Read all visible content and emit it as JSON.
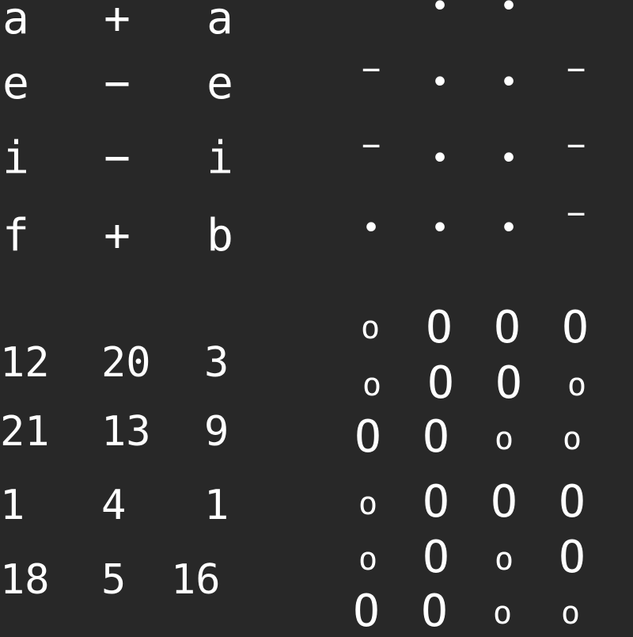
{
  "letter_grid": {
    "rows": [
      [
        "a",
        "+",
        "a"
      ],
      [
        "e",
        "−",
        "e"
      ],
      [
        "i",
        "−",
        "i"
      ],
      [
        "f",
        "+",
        "b"
      ]
    ]
  },
  "symbol_grid": {
    "rows": [
      [
        "",
        "•",
        "•",
        ""
      ],
      [
        "−",
        "•",
        "•",
        "−"
      ],
      [
        "−",
        "•",
        "•",
        "−"
      ],
      [
        "•",
        "•",
        "•",
        "−"
      ]
    ]
  },
  "number_grid": {
    "rows": [
      [
        "12",
        "20",
        "3"
      ],
      [
        "21",
        "13",
        "9"
      ],
      [
        "1",
        "4",
        "1"
      ],
      [
        "18",
        "5",
        "16"
      ]
    ]
  },
  "circle_grid": {
    "rows": [
      [
        "o",
        "O",
        "O",
        "O"
      ],
      [
        "o",
        "O",
        "O",
        "o"
      ],
      [
        "O",
        "O",
        "o",
        "o"
      ],
      [
        "o",
        "O",
        "O",
        "O"
      ],
      [
        "o",
        "O",
        "o",
        "O"
      ],
      [
        "O",
        "O",
        "o",
        "o"
      ]
    ]
  }
}
